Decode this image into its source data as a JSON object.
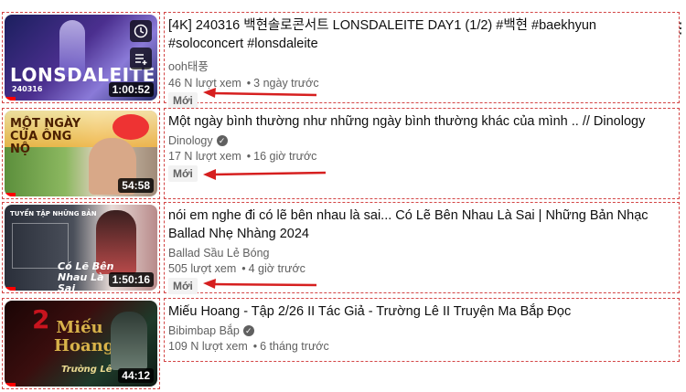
{
  "colors": {
    "accent": "#ff0000",
    "annotation": "#d61f1f"
  },
  "videos": [
    {
      "title": "[4K] 240316 백현솔로콘서트 LONSDALEITE DAY1 (1/2) #백현 #baekhyun #soloconcert #lonsdaleite",
      "channel": "ooh태풍",
      "verified": false,
      "views": "46 N lượt xem",
      "age": "3 ngày trước",
      "badge": "Mới",
      "duration": "1:00:52",
      "thumb_text": "LONSDALEITE",
      "thumb_sub": "240316"
    },
    {
      "title": "Một ngày bình thường như những ngày bình thường khác của mình .. // Dinology",
      "channel": "Dinology",
      "verified": true,
      "views": "17 N lượt xem",
      "age": "16 giờ trước",
      "badge": "Mới",
      "duration": "54:58",
      "thumb_text": "MỘT NGÀY CỦA ÔNG NỘ"
    },
    {
      "title": "nói em nghe đi có lẽ bên nhau là sai... Có Lẽ Bên Nhau Là Sai | Những Bản Nhạc Ballad Nhẹ Nhàng 2024",
      "channel": "Ballad Sầu Lẻ Bóng",
      "verified": false,
      "views": "505 lượt xem",
      "age": "4 giờ trước",
      "badge": "Mới",
      "duration": "1:50:16",
      "thumb_text": "TUYỂN TẬP NHỮNG BẢN",
      "thumb_sub": "Có Lẽ Bên Nhau Là Sai"
    },
    {
      "title": "Miếu Hoang - Tập 2/26 II Tác Giả - Trường Lê II Truyện Ma Bắp Đọc",
      "channel": "Bibimbap Bắp",
      "verified": true,
      "views": "109 N lượt xem",
      "age": "6 tháng trước",
      "duration": "44:12",
      "thumb_text": "Miếu Hoang",
      "thumb_num": "2",
      "thumb_sub": "Trường Lê"
    }
  ]
}
